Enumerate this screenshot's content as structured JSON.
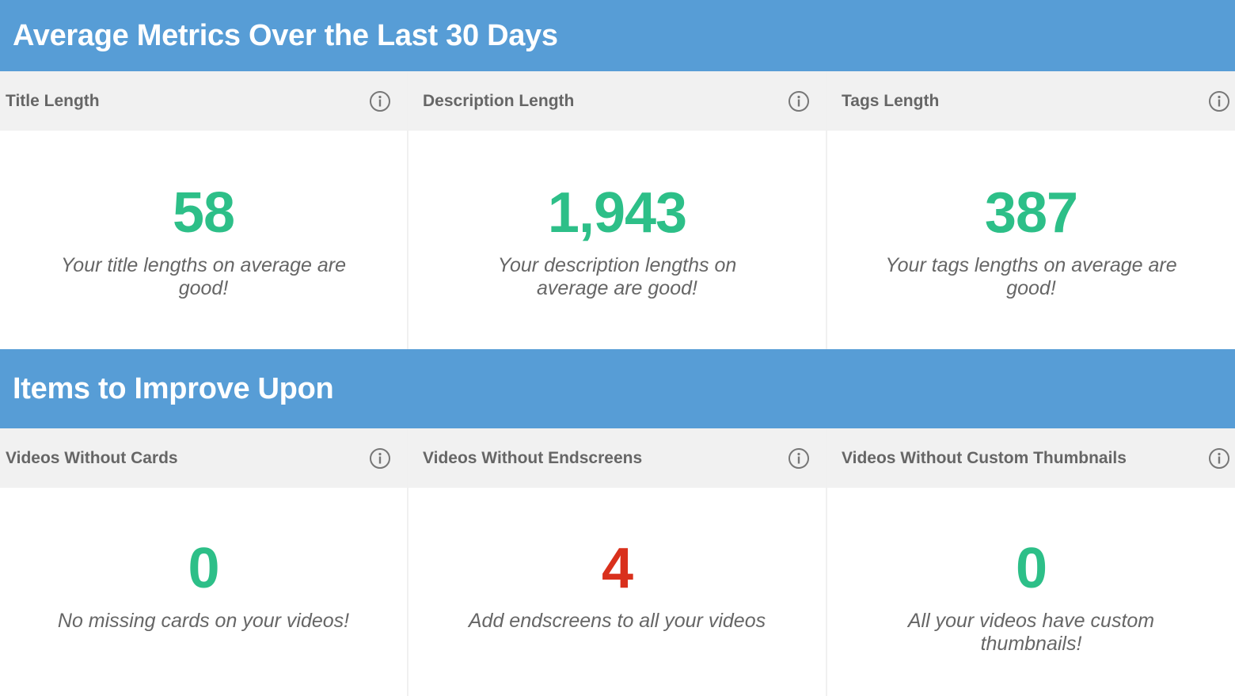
{
  "sections": [
    {
      "title": "Average Metrics Over the Last 30 Days",
      "cards": [
        {
          "label": "Title Length",
          "value": "58",
          "value_color": "#2dbf88",
          "message": "Your title lengths on average are good!"
        },
        {
          "label": "Description Length",
          "value": "1,943",
          "value_color": "#2dbf88",
          "message": "Your description lengths on average are good!"
        },
        {
          "label": "Tags Length",
          "value": "387",
          "value_color": "#2dbf88",
          "message": "Your tags lengths on average are good!"
        }
      ]
    },
    {
      "title": "Items to Improve Upon",
      "cards": [
        {
          "label": "Videos Without Cards",
          "value": "0",
          "value_color": "#2dbf88",
          "message": "No missing cards on your videos!"
        },
        {
          "label": "Videos Without Endscreens",
          "value": "4",
          "value_color": "#d9301c",
          "message": "Add endscreens to all your videos"
        },
        {
          "label": "Videos Without Custom Thumbnails",
          "value": "0",
          "value_color": "#2dbf88",
          "message": "All your videos have custom thumbnails!"
        }
      ]
    }
  ],
  "icons": {
    "info": "info-circle-icon"
  },
  "colors": {
    "header_bg": "#579dd6",
    "good": "#2dbf88",
    "bad": "#d9301c"
  }
}
